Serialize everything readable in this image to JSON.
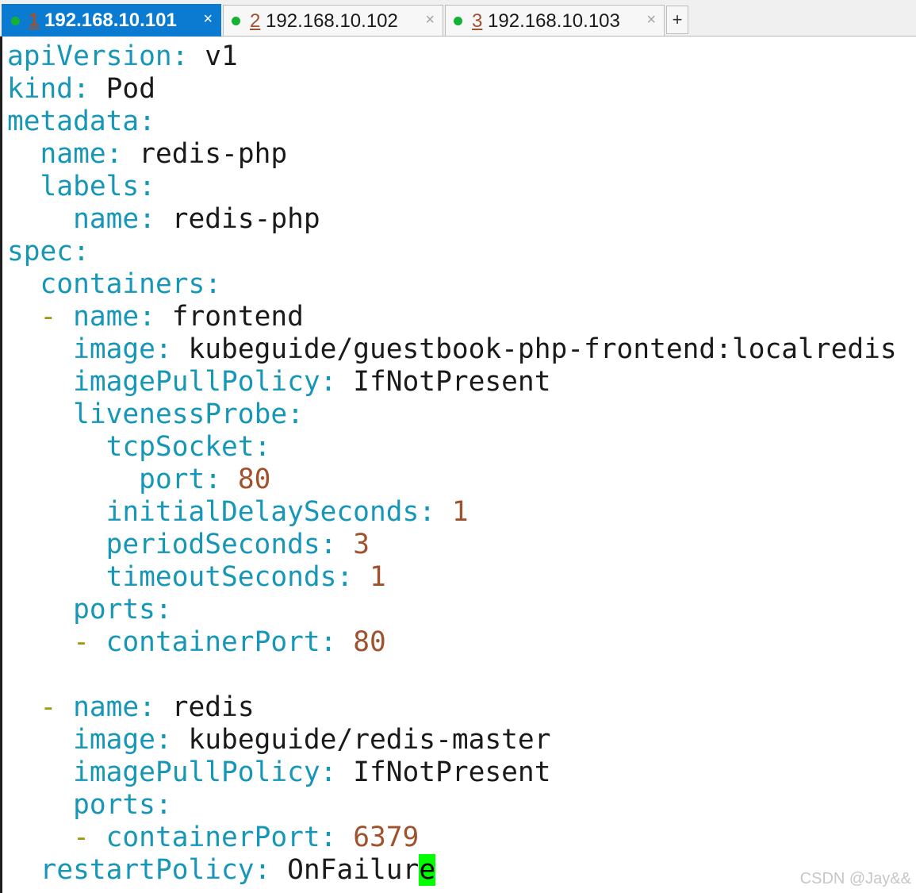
{
  "tabs": [
    {
      "num": "1",
      "host": " 192.168.10.101",
      "active": true
    },
    {
      "num": "2",
      "host": " 192.168.10.102",
      "active": false
    },
    {
      "num": "3",
      "host": " 192.168.10.103",
      "active": false
    }
  ],
  "new_tab_label": "+",
  "close_glyph": "×",
  "colors": {
    "active_tab": "#0a7bd1",
    "status_dot": "#13b233",
    "yaml_key": "#1797b8",
    "yaml_number": "#a0522d",
    "yaml_dash": "#a0980b",
    "cursor": "#00ff00"
  },
  "yaml": [
    {
      "indent": "",
      "dash": "",
      "key": "apiVersion",
      "value": "v1",
      "type": "str"
    },
    {
      "indent": "",
      "dash": "",
      "key": "kind",
      "value": "Pod",
      "type": "str"
    },
    {
      "indent": "",
      "dash": "",
      "key": "metadata",
      "value": "",
      "type": "str"
    },
    {
      "indent": "  ",
      "dash": "",
      "key": "name",
      "value": "redis-php",
      "type": "str"
    },
    {
      "indent": "  ",
      "dash": "",
      "key": "labels",
      "value": "",
      "type": "str"
    },
    {
      "indent": "    ",
      "dash": "",
      "key": "name",
      "value": "redis-php",
      "type": "str"
    },
    {
      "indent": "",
      "dash": "",
      "key": "spec",
      "value": "",
      "type": "str"
    },
    {
      "indent": "  ",
      "dash": "",
      "key": "containers",
      "value": "",
      "type": "str"
    },
    {
      "indent": "  ",
      "dash": "- ",
      "key": "name",
      "value": "frontend",
      "type": "str"
    },
    {
      "indent": "    ",
      "dash": "",
      "key": "image",
      "value": "kubeguide/guestbook-php-frontend:localredis",
      "type": "str"
    },
    {
      "indent": "    ",
      "dash": "",
      "key": "imagePullPolicy",
      "value": "IfNotPresent",
      "type": "str"
    },
    {
      "indent": "    ",
      "dash": "",
      "key": "livenessProbe",
      "value": "",
      "type": "str"
    },
    {
      "indent": "      ",
      "dash": "",
      "key": "tcpSocket",
      "value": "",
      "type": "str"
    },
    {
      "indent": "        ",
      "dash": "",
      "key": "port",
      "value": "80",
      "type": "num"
    },
    {
      "indent": "      ",
      "dash": "",
      "key": "initialDelaySeconds",
      "value": "1",
      "type": "num"
    },
    {
      "indent": "      ",
      "dash": "",
      "key": "periodSeconds",
      "value": "3",
      "type": "num"
    },
    {
      "indent": "      ",
      "dash": "",
      "key": "timeoutSeconds",
      "value": "1",
      "type": "num"
    },
    {
      "indent": "    ",
      "dash": "",
      "key": "ports",
      "value": "",
      "type": "str"
    },
    {
      "indent": "    ",
      "dash": "- ",
      "key": "containerPort",
      "value": "80",
      "type": "num"
    },
    {
      "indent": "",
      "dash": "",
      "key": "",
      "value": "",
      "type": "blank"
    },
    {
      "indent": "  ",
      "dash": "- ",
      "key": "name",
      "value": "redis",
      "type": "str"
    },
    {
      "indent": "    ",
      "dash": "",
      "key": "image",
      "value": "kubeguide/redis-master",
      "type": "str"
    },
    {
      "indent": "    ",
      "dash": "",
      "key": "imagePullPolicy",
      "value": "IfNotPresent",
      "type": "str"
    },
    {
      "indent": "    ",
      "dash": "",
      "key": "ports",
      "value": "",
      "type": "str"
    },
    {
      "indent": "    ",
      "dash": "- ",
      "key": "containerPort",
      "value": "6379",
      "type": "num"
    },
    {
      "indent": "  ",
      "dash": "",
      "key": "restartPolicy",
      "value": "OnFailure",
      "type": "str",
      "cursor_at_end": true
    }
  ],
  "watermark": "CSDN @Jay&&"
}
